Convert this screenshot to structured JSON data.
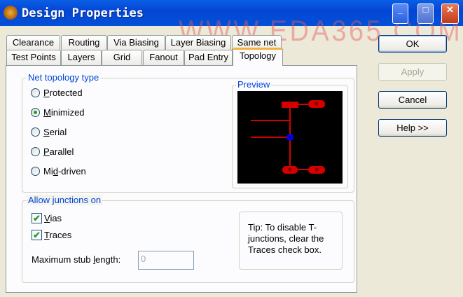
{
  "window": {
    "title": "Design Properties",
    "watermark": "WWW.EDA365.COM",
    "minimize": "_",
    "maximize": "□",
    "close": "✕"
  },
  "tabs_row1": [
    "Clearance",
    "Routing",
    "Via Biasing",
    "Layer Biasing",
    "Same net"
  ],
  "tabs_row2": [
    "Test Points",
    "Layers",
    "Grid",
    "Fanout",
    "Pad Entry",
    "Topology"
  ],
  "active_tab": "Topology",
  "topology": {
    "label": "Net topology type",
    "options": [
      {
        "pre": "",
        "u": "P",
        "post": "rotected",
        "checked": false
      },
      {
        "pre": "",
        "u": "M",
        "post": "inimized",
        "checked": true
      },
      {
        "pre": "",
        "u": "S",
        "post": "erial",
        "checked": false
      },
      {
        "pre": "",
        "u": "P",
        "post": "arallel",
        "checked": false
      },
      {
        "pre": "Mi",
        "u": "d",
        "post": "-driven",
        "checked": false
      }
    ]
  },
  "preview": {
    "label": "Preview",
    "trace_color": "#D40000",
    "via_color": "#0000FF"
  },
  "junctions": {
    "label": "Allow junctions on",
    "vias": {
      "u": "V",
      "post": "ias",
      "checked": true
    },
    "traces": {
      "u": "T",
      "post": "races",
      "checked": true
    },
    "stub_pre": "Maximum stub ",
    "stub_u": "l",
    "stub_post": "ength:",
    "stub_value": "0"
  },
  "tip": [
    "Tip: To disable T-",
    "junctions, clear the",
    "Traces check box."
  ],
  "buttons": {
    "ok": "OK",
    "apply": "Apply",
    "cancel": "Cancel",
    "help": "Help >>"
  }
}
